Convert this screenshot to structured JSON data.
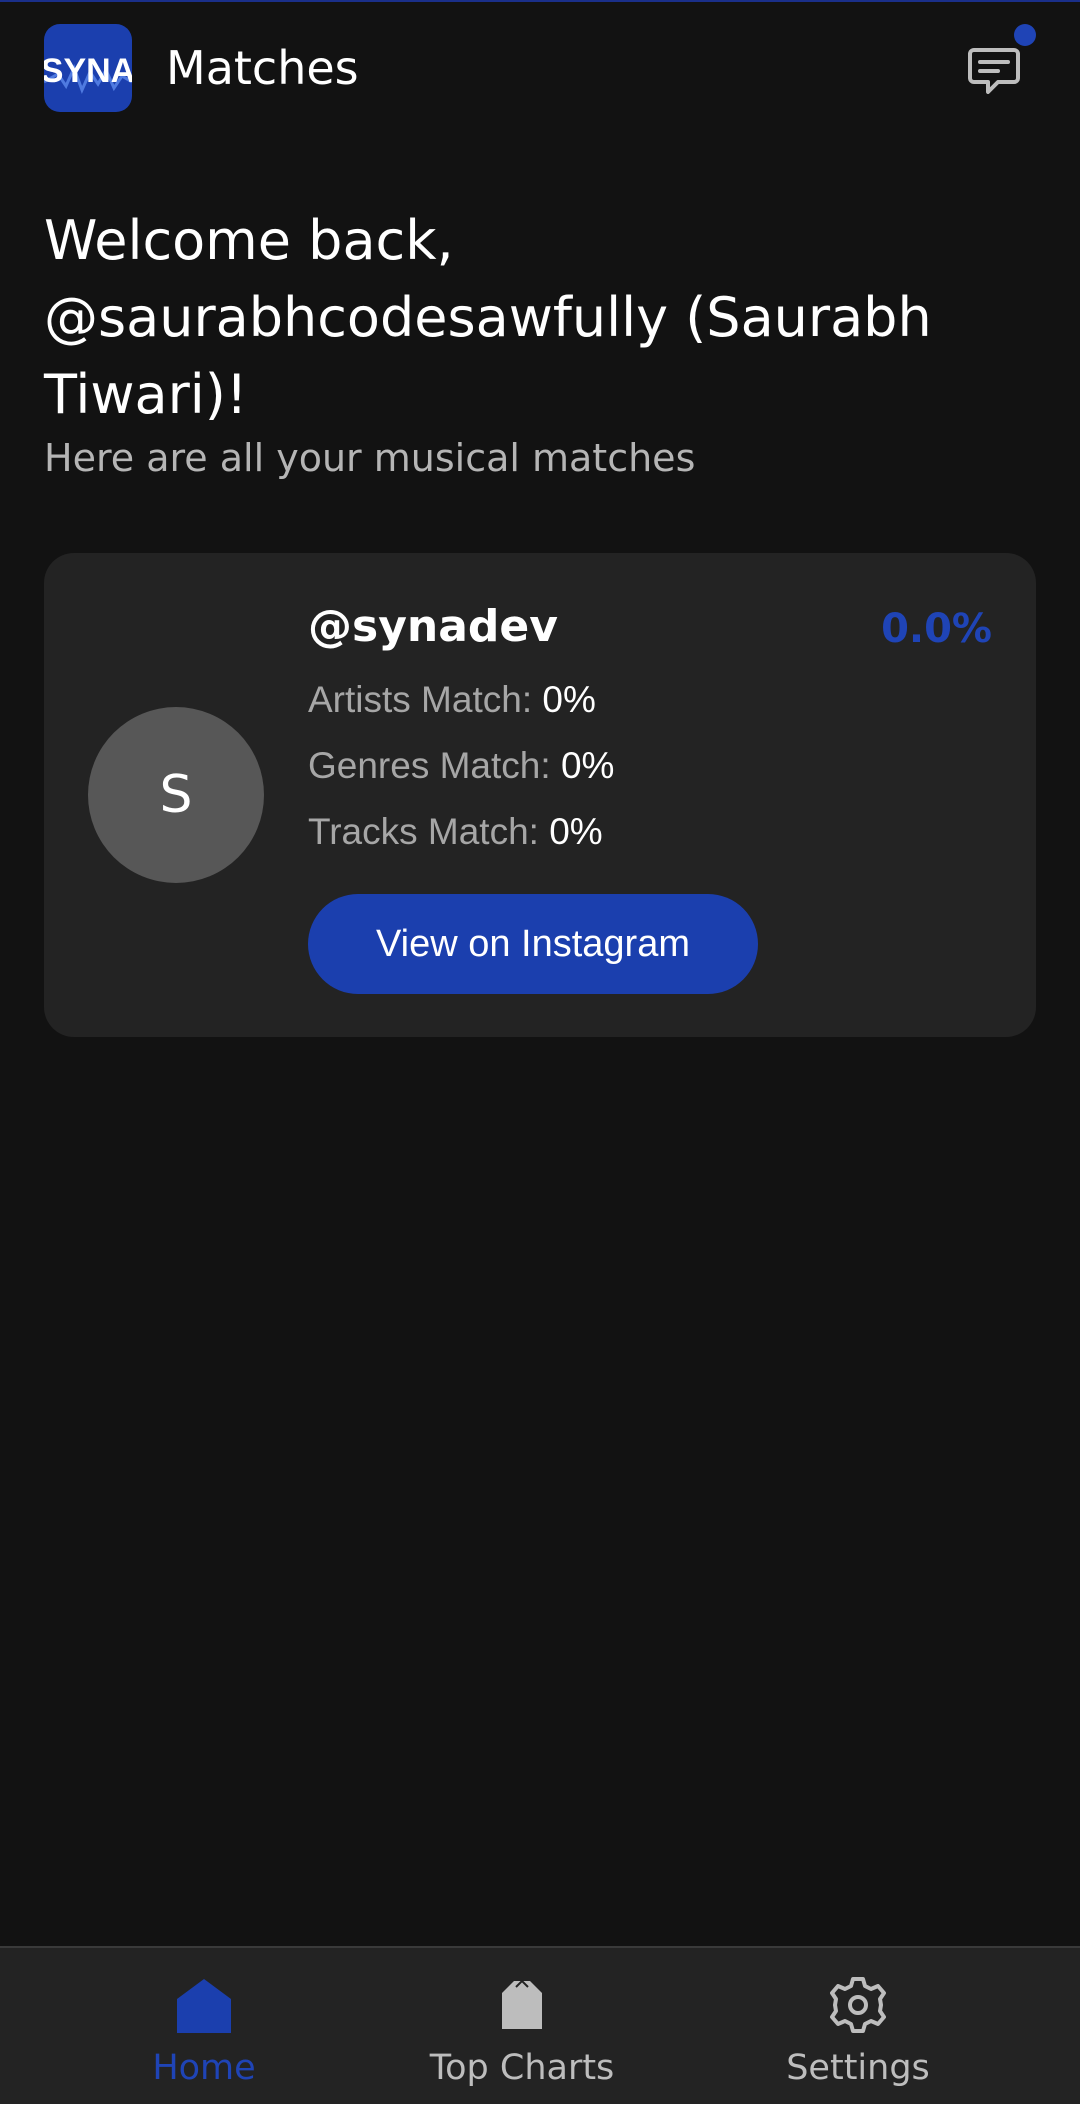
{
  "header": {
    "logo_text": "SYNA",
    "title": "Matches",
    "has_notification": true
  },
  "welcome": {
    "title": "Welcome back, @saurabhcodesawfully (Saurabh Tiwari)!",
    "subtitle": "Here are all your musical matches"
  },
  "matches": [
    {
      "avatar_initial": "S",
      "username": "@synadev",
      "overall_percent": "0.0%",
      "artists_label": "Artists Match:",
      "artists_value": "0%",
      "genres_label": "Genres Match:",
      "genres_value": "0%",
      "tracks_label": "Tracks Match:",
      "tracks_value": "0%",
      "button_label": "View on Instagram"
    }
  ],
  "nav": {
    "items": [
      {
        "label": "Home",
        "icon": "home-icon",
        "active": true
      },
      {
        "label": "Top Charts",
        "icon": "charts-icon",
        "active": false
      },
      {
        "label": "Settings",
        "icon": "gear-icon",
        "active": false
      }
    ]
  },
  "colors": {
    "background": "#121212",
    "card": "#232323",
    "accent": "#1f44b6",
    "button": "#1b3fae"
  }
}
